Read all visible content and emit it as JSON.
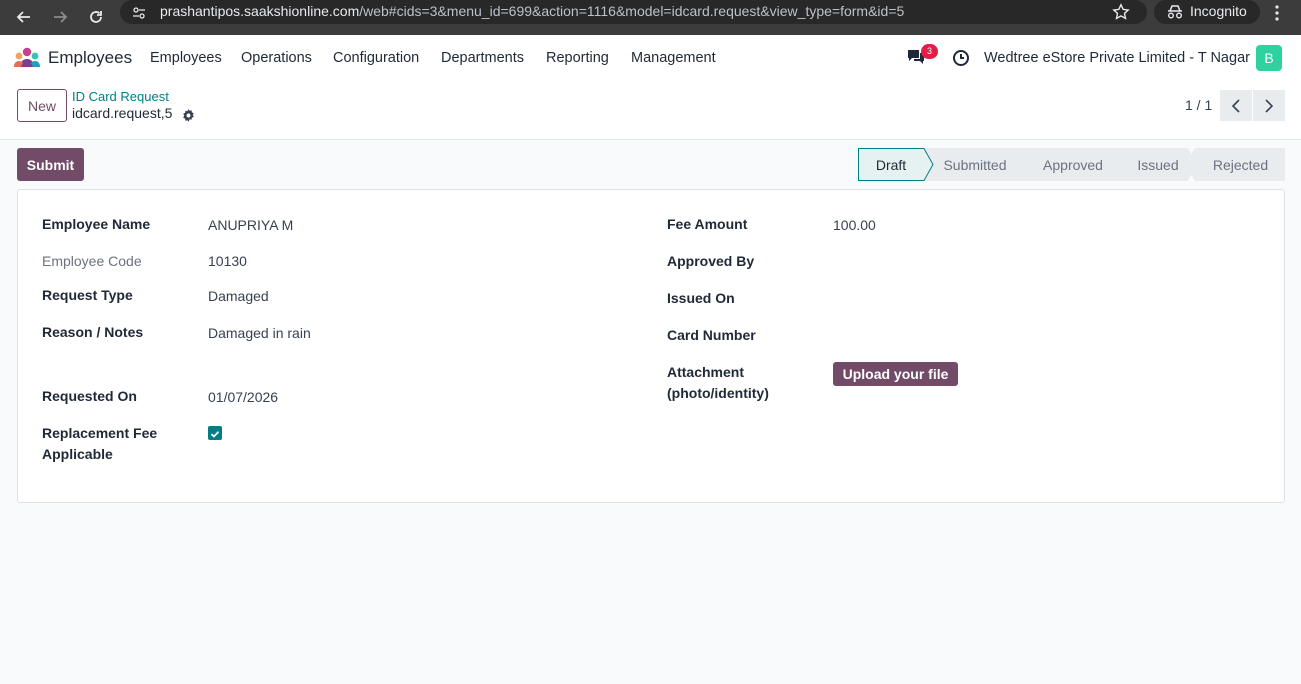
{
  "browser": {
    "url_host": "prashantipos.saakshionline.com",
    "url_path": "/web#cids=3&menu_id=699&action=1116&model=idcard.request&view_type=form&id=5",
    "incognito_label": "Incognito"
  },
  "navbar": {
    "app_name": "Employees",
    "menu": [
      "Employees",
      "Operations",
      "Configuration",
      "Departments",
      "Reporting",
      "Management"
    ],
    "chat_badge": "3",
    "company": "Wedtree eStore Private Limited - T Nagar",
    "avatar_letter": "B"
  },
  "control": {
    "new_label": "New",
    "breadcrumb_parent": "ID Card Request",
    "breadcrumb_current": "idcard.request,5",
    "pager": "1 / 1"
  },
  "status": {
    "submit_label": "Submit",
    "stages": [
      "Draft",
      "Submitted",
      "Approved",
      "Issued",
      "Rejected"
    ],
    "active_stage": "Draft"
  },
  "form": {
    "employee_name_label": "Employee Name",
    "employee_name": "ANUPRIYA M",
    "employee_code_label": "Employee Code",
    "employee_code": "10130",
    "request_type_label": "Request Type",
    "request_type": "Damaged",
    "reason_label": "Reason / Notes",
    "reason": "Damaged in rain",
    "requested_on_label": "Requested On",
    "requested_on": "01/07/2026",
    "fee_applicable_label_1": "Replacement Fee",
    "fee_applicable_label_2": "Applicable",
    "fee_amount_label": "Fee Amount",
    "fee_amount": "100.00",
    "approved_by_label": "Approved By",
    "issued_on_label": "Issued On",
    "card_number_label": "Card Number",
    "attachment_label_1": "Attachment",
    "attachment_label_2": "(photo/identity)",
    "upload_label": "Upload your file"
  },
  "colors": {
    "brand": "#714b67",
    "teal": "#017e84",
    "badge": "#e11d48",
    "avatar": "#2ed1a0"
  }
}
